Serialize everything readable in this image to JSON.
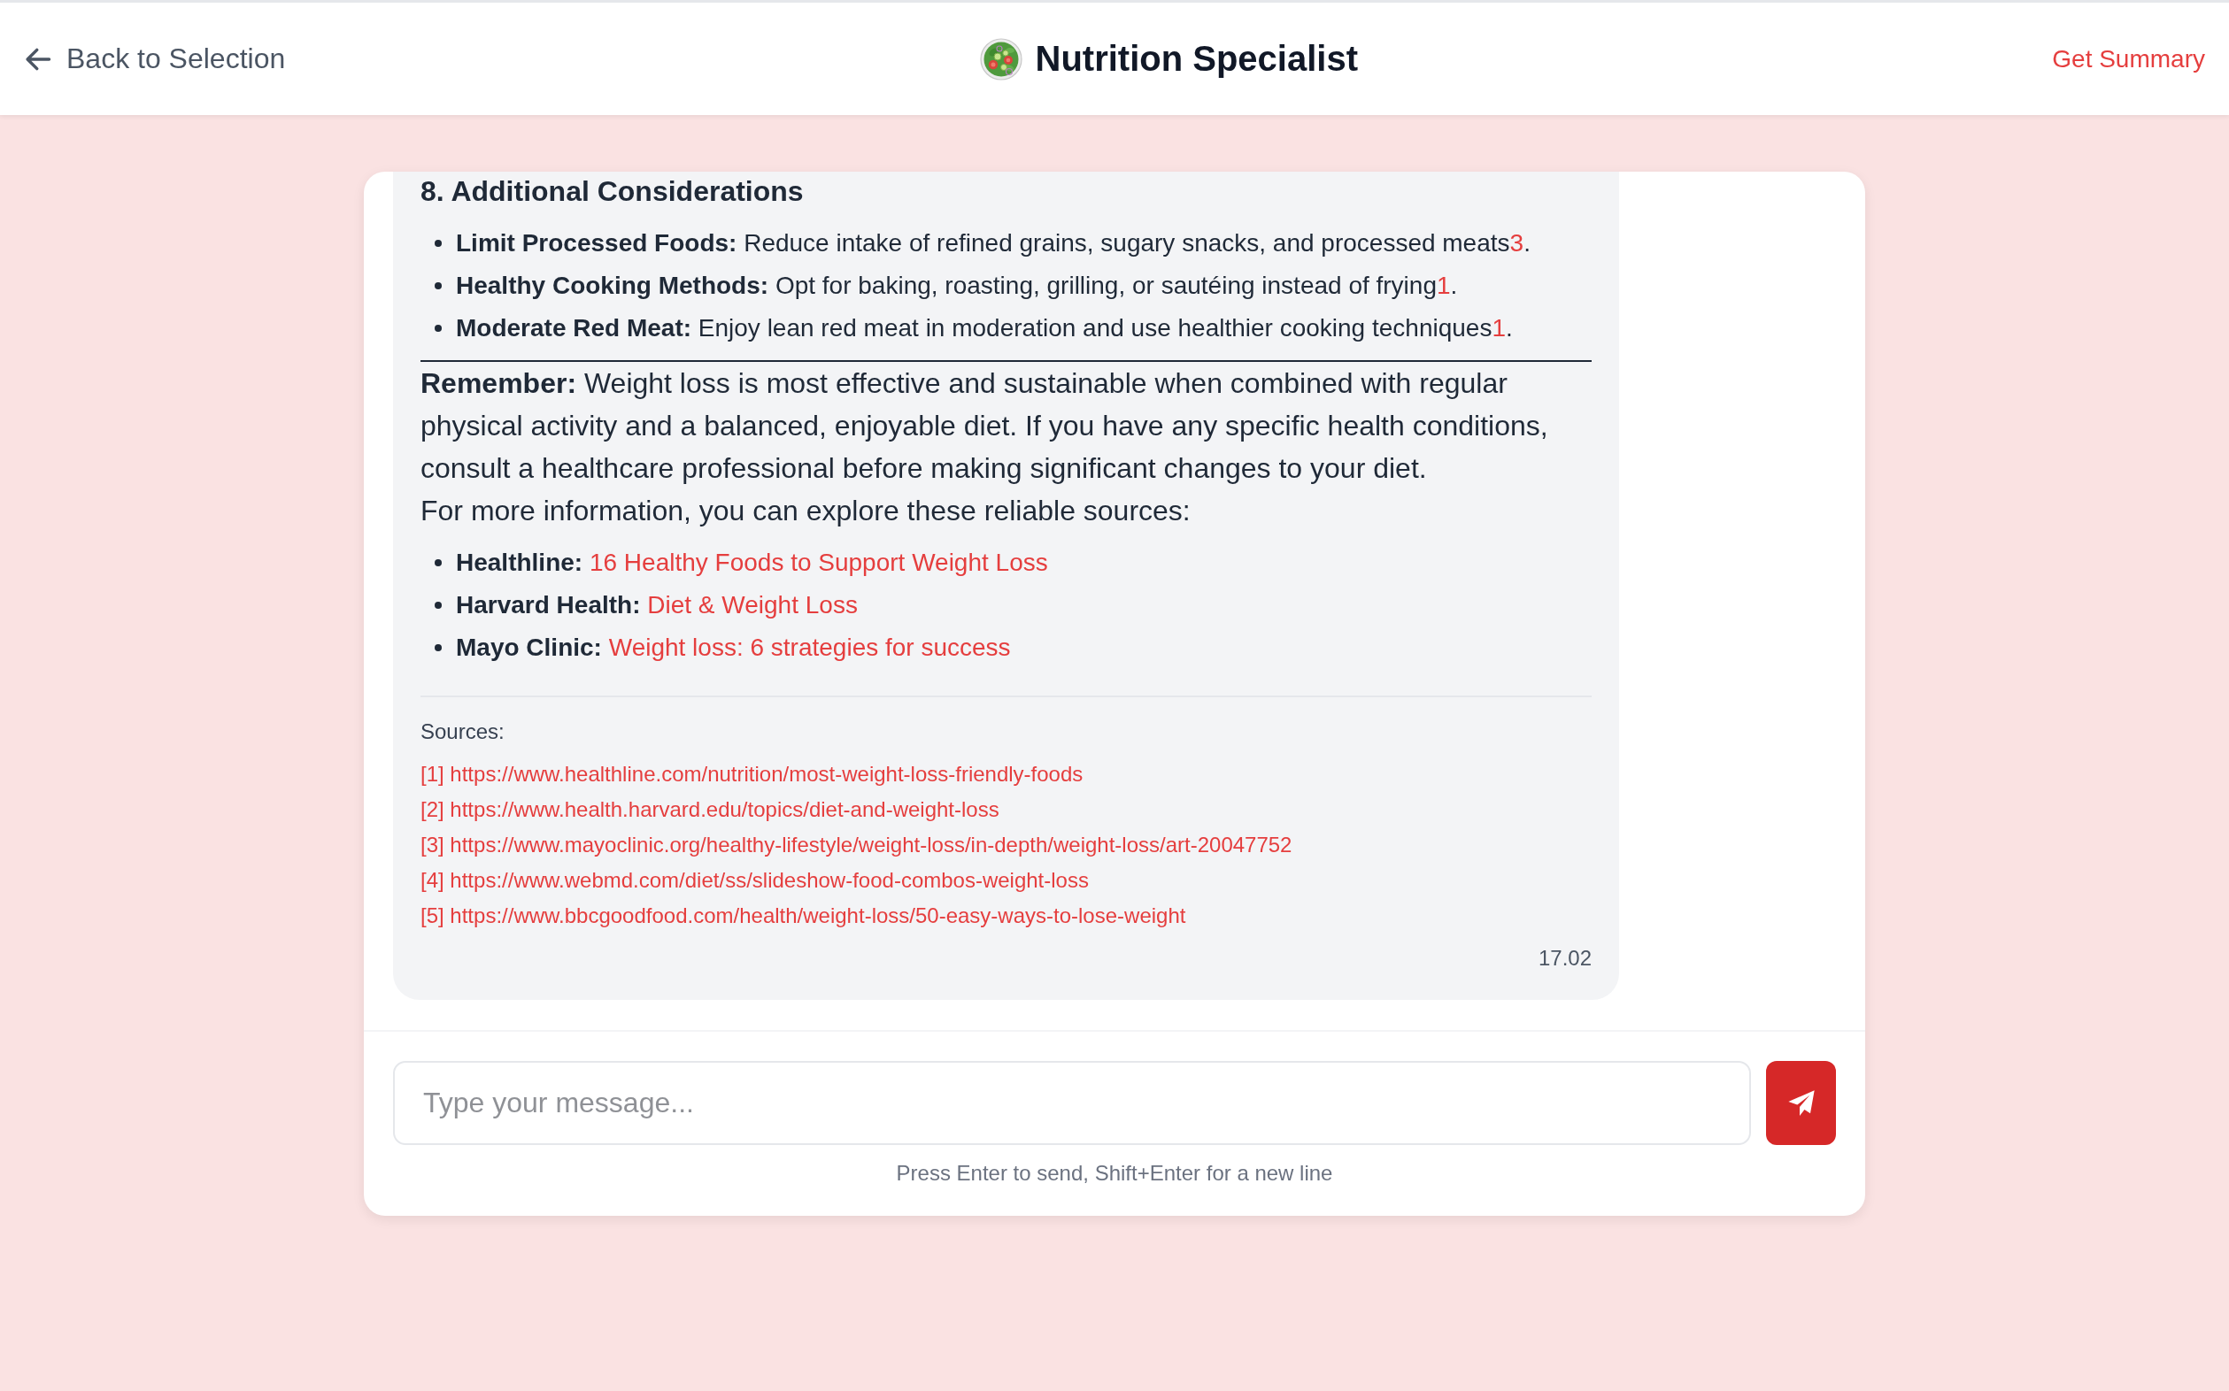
{
  "header": {
    "back_link": "Back to Selection",
    "title": "Nutrition Specialist",
    "summary_button": "Get Summary"
  },
  "messages": [
    {
      "blocks": [
        {
          "kind": "heading",
          "text": "8. Additional Considerations"
        },
        {
          "kind": "bullets",
          "items": [
            {
              "text": "**Limit Processed Foods:** Reduce intake of refined grains, sugary snacks, and processed meats",
              "citation": "3",
              "tail": "."
            },
            {
              "text": "**Healthy Cooking Methods:** Opt for baking, roasting, grilling, or sautéing instead of frying",
              "citation": "1",
              "tail": "."
            },
            {
              "text": "**Moderate Red Meat:** Enjoy lean red meat in moderation and use healthier cooking techniques",
              "citation": "1",
              "tail": "."
            }
          ]
        },
        {
          "kind": "rule"
        },
        {
          "kind": "paragraph",
          "text": "**Remember:** Weight loss is most effective and sustainable when combined with regular physical activity and a balanced, enjoyable diet. If you have any specific health conditions, consult a healthcare professional before making significant changes to your diet."
        },
        {
          "kind": "paragraph",
          "text": "For more information, you can explore these reliable sources:"
        },
        {
          "kind": "links",
          "items": [
            {
              "label": "Healthline:",
              "link": "16 Healthy Foods to Support Weight Loss"
            },
            {
              "label": "Harvard Health:",
              "link": "Diet & Weight Loss"
            },
            {
              "label": "Mayo Clinic:",
              "link": "Weight loss: 6 strategies for success"
            }
          ]
        }
      ],
      "sources_label": "Sources:",
      "sources": [
        "[1] https://www.healthline.com/nutrition/most-weight-loss-friendly-foods",
        "[2] https://www.health.harvard.edu/topics/diet-and-weight-loss",
        "[3] https://www.mayoclinic.org/healthy-lifestyle/weight-loss/in-depth/weight-loss/art-20047752",
        "[4] https://www.webmd.com/diet/ss/slideshow-food-combos-weight-loss",
        "[5] https://www.bbcgoodfood.com/health/weight-loss/50-easy-ways-to-lose-weight"
      ],
      "time": "17.02"
    }
  ],
  "composer": {
    "placeholder": "Type your message...",
    "hint": "Press Enter to send, Shift+Enter for a new line"
  }
}
